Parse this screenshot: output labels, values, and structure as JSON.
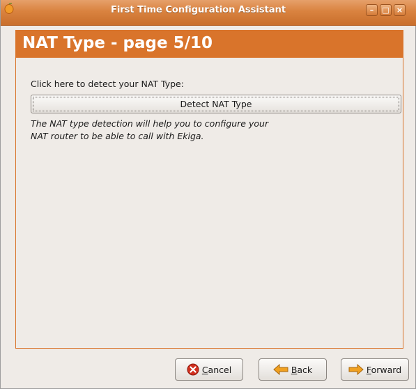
{
  "window": {
    "title": "First Time Configuration Assistant",
    "controls": {
      "minimize": "–",
      "maximize": "□",
      "close": "×"
    }
  },
  "header": {
    "title": "NAT Type - page 5/10"
  },
  "content": {
    "prompt": "Click here to detect your NAT Type:",
    "detect_button_label": "Detect NAT Type",
    "description": "The NAT type detection will help you to configure your NAT router to be able to call with Ekiga."
  },
  "footer": {
    "cancel_mnemonic": "C",
    "cancel_rest": "ancel",
    "back_mnemonic": "B",
    "back_rest": "ack",
    "forward_mnemonic": "F",
    "forward_rest": "orward"
  },
  "icons": {
    "app": "ekiga-app-icon",
    "cancel": "cancel-icon",
    "back": "back-arrow-icon",
    "forward": "forward-arrow-icon"
  },
  "colors": {
    "accent": "#d9742b",
    "window_bg": "#efebe7"
  }
}
